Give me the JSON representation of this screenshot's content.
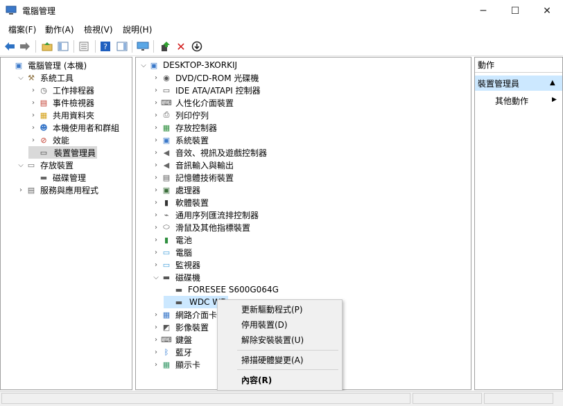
{
  "window": {
    "title": "電腦管理"
  },
  "menubar": [
    "檔案(F)",
    "動作(A)",
    "檢視(V)",
    "說明(H)"
  ],
  "toolbar": [
    {
      "icon": "back-arrow-icon"
    },
    {
      "icon": "forward-arrow-icon"
    },
    {
      "icon": "up-folder-icon"
    },
    {
      "icon": "show-hide-tree-icon"
    },
    {
      "icon": "properties-icon"
    },
    {
      "icon": "help-icon"
    },
    {
      "icon": "action-pane-icon"
    },
    {
      "icon": "monitor-icon"
    },
    {
      "icon": "update-driver-icon"
    },
    {
      "icon": "uninstall-x-icon"
    },
    {
      "icon": "disable-device-icon"
    }
  ],
  "left_tree": [
    {
      "label": "電腦管理 (本機)",
      "level": 0,
      "chev": "",
      "icon": "computer-management-icon"
    },
    {
      "label": "系統工具",
      "level": 1,
      "chev": "open",
      "icon": "system-tools-icon"
    },
    {
      "label": "工作排程器",
      "level": 2,
      "chev": "closed",
      "icon": "task-scheduler-icon"
    },
    {
      "label": "事件檢視器",
      "level": 2,
      "chev": "closed",
      "icon": "event-viewer-icon"
    },
    {
      "label": "共用資料夾",
      "level": 2,
      "chev": "closed",
      "icon": "shared-folders-icon"
    },
    {
      "label": "本機使用者和群組",
      "level": 2,
      "chev": "closed",
      "icon": "users-groups-icon"
    },
    {
      "label": "效能",
      "level": 2,
      "chev": "closed",
      "icon": "performance-icon"
    },
    {
      "label": "裝置管理員",
      "level": 2,
      "chev": "",
      "icon": "device-manager-icon",
      "selected": true
    },
    {
      "label": "存放裝置",
      "level": 1,
      "chev": "open",
      "icon": "storage-icon"
    },
    {
      "label": "磁碟管理",
      "level": 2,
      "chev": "",
      "icon": "disk-management-icon"
    },
    {
      "label": "服務與應用程式",
      "level": 1,
      "chev": "closed",
      "icon": "services-apps-icon"
    }
  ],
  "device_tree": [
    {
      "label": "DESKTOP-3KORKIJ",
      "level": 0,
      "chev": "open",
      "icon": "computer-icon"
    },
    {
      "label": "DVD/CD-ROM 光碟機",
      "level": 1,
      "chev": "closed",
      "icon": "dvd-drive-icon"
    },
    {
      "label": "IDE ATA/ATAPI 控制器",
      "level": 1,
      "chev": "closed",
      "icon": "ide-controller-icon"
    },
    {
      "label": "人性化介面裝置",
      "level": 1,
      "chev": "closed",
      "icon": "hid-icon"
    },
    {
      "label": "列印佇列",
      "level": 1,
      "chev": "closed",
      "icon": "printer-icon"
    },
    {
      "label": "存放控制器",
      "level": 1,
      "chev": "closed",
      "icon": "storage-controller-icon"
    },
    {
      "label": "系統裝置",
      "level": 1,
      "chev": "closed",
      "icon": "system-devices-icon"
    },
    {
      "label": "音效、視訊及遊戲控制器",
      "level": 1,
      "chev": "closed",
      "icon": "speaker-icon"
    },
    {
      "label": "音訊輸入與輸出",
      "level": 1,
      "chev": "closed",
      "icon": "audio-io-icon"
    },
    {
      "label": "記憶體技術裝置",
      "level": 1,
      "chev": "closed",
      "icon": "memory-icon"
    },
    {
      "label": "處理器",
      "level": 1,
      "chev": "closed",
      "icon": "processor-icon"
    },
    {
      "label": "軟體裝置",
      "level": 1,
      "chev": "closed",
      "icon": "software-device-icon"
    },
    {
      "label": "通用序列匯流排控制器",
      "level": 1,
      "chev": "closed",
      "icon": "usb-icon"
    },
    {
      "label": "滑鼠及其他指標裝置",
      "level": 1,
      "chev": "closed",
      "icon": "mouse-icon"
    },
    {
      "label": "電池",
      "level": 1,
      "chev": "closed",
      "icon": "battery-icon"
    },
    {
      "label": "電腦",
      "level": 1,
      "chev": "closed",
      "icon": "pc-icon"
    },
    {
      "label": "監視器",
      "level": 1,
      "chev": "closed",
      "icon": "monitor-icon"
    },
    {
      "label": "磁碟機",
      "level": 1,
      "chev": "open",
      "icon": "disk-drive-icon"
    },
    {
      "label": "FORESEE S600G064G",
      "level": 2,
      "chev": "",
      "icon": "disk-drive-icon"
    },
    {
      "label": "WDC WD",
      "level": 2,
      "chev": "",
      "icon": "disk-drive-icon",
      "selected": true
    },
    {
      "label": "網路介面卡",
      "level": 1,
      "chev": "closed",
      "icon": "network-adapter-icon"
    },
    {
      "label": "影像裝置",
      "level": 1,
      "chev": "closed",
      "icon": "imaging-device-icon"
    },
    {
      "label": "鍵盤",
      "level": 1,
      "chev": "closed",
      "icon": "keyboard-icon"
    },
    {
      "label": "藍牙",
      "level": 1,
      "chev": "closed",
      "icon": "bluetooth-icon"
    },
    {
      "label": "顯示卡",
      "level": 1,
      "chev": "closed",
      "icon": "display-adapter-icon"
    }
  ],
  "actions": {
    "header": "動作",
    "section": "裝置管理員",
    "more": "其他動作"
  },
  "context_menu": [
    {
      "label": "更新驅動程式(P)"
    },
    {
      "label": "停用裝置(D)"
    },
    {
      "label": "解除安裝裝置(U)"
    },
    {
      "label": "掃描硬體變更(A)"
    },
    {
      "label": "內容(R)",
      "bold": true
    }
  ],
  "statusbar": {
    "text": ""
  },
  "colors": {
    "selection_blue": "#cce8ff",
    "selection_gray": "#d9d9d9",
    "toolbar_help_blue": "#1f5fbf",
    "uninstall_red": "#d21a1a"
  }
}
